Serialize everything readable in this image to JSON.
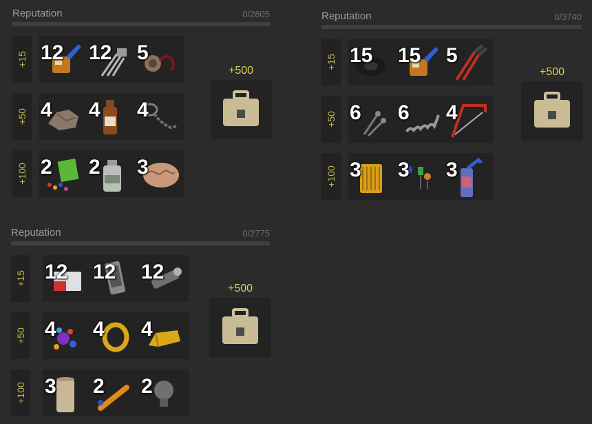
{
  "panels": [
    {
      "title": "Reputation",
      "count": "0/2805",
      "reward": "+500",
      "reward_icon": "briefcase-icon",
      "tiers": [
        {
          "label": "+15",
          "items": [
            {
              "qty": "12",
              "icon": "super-glue-icon"
            },
            {
              "qty": "12",
              "icon": "wire-cutter-icon"
            },
            {
              "qty": "5",
              "icon": "power-cord-icon"
            }
          ]
        },
        {
          "label": "+50",
          "items": [
            {
              "qty": "4",
              "icon": "rock-ore-icon"
            },
            {
              "qty": "4",
              "icon": "medicine-bottle-icon"
            },
            {
              "qty": "4",
              "icon": "chain-icon"
            }
          ]
        },
        {
          "label": "+100",
          "items": [
            {
              "qty": "2",
              "icon": "pills-pack-icon"
            },
            {
              "qty": "2",
              "icon": "vial-icon"
            },
            {
              "qty": "3",
              "icon": "brain-icon"
            }
          ]
        }
      ]
    },
    {
      "title": "Reputation",
      "count": "0/3740",
      "reward": "+500",
      "reward_icon": "briefcase-icon",
      "tiers": [
        {
          "label": "+15",
          "items": [
            {
              "qty": "15",
              "icon": "tape-roll-icon"
            },
            {
              "qty": "15",
              "icon": "super-glue-icon"
            },
            {
              "qty": "5",
              "icon": "pliers-icon"
            }
          ]
        },
        {
          "label": "+50",
          "items": [
            {
              "qty": "6",
              "icon": "nails-icon"
            },
            {
              "qty": "6",
              "icon": "spring-icon"
            },
            {
              "qty": "4",
              "icon": "hacksaw-icon"
            }
          ]
        },
        {
          "label": "+100",
          "items": [
            {
              "qty": "3",
              "icon": "filter-icon"
            },
            {
              "qty": "3",
              "icon": "electronic-parts-icon"
            },
            {
              "qty": "3",
              "icon": "spray-can-icon"
            }
          ]
        }
      ]
    },
    {
      "title": "Reputation",
      "count": "0/2775",
      "reward": "+500",
      "reward_icon": "briefcase-icon",
      "tiers": [
        {
          "label": "+15",
          "items": [
            {
              "qty": "12",
              "icon": "cigarette-pack-icon"
            },
            {
              "qty": "12",
              "icon": "phone-icon"
            },
            {
              "qty": "12",
              "icon": "flashlight-icon"
            }
          ]
        },
        {
          "label": "+50",
          "items": [
            {
              "qty": "4",
              "icon": "gem-cluster-icon"
            },
            {
              "qty": "4",
              "icon": "gold-ring-icon"
            },
            {
              "qty": "4",
              "icon": "gold-bar-icon"
            }
          ]
        },
        {
          "label": "+100",
          "items": [
            {
              "qty": "3",
              "icon": "paper-scroll-icon"
            },
            {
              "qty": "2",
              "icon": "marker-icon"
            },
            {
              "qty": "2",
              "icon": "light-bulb-icon"
            }
          ]
        }
      ]
    }
  ]
}
